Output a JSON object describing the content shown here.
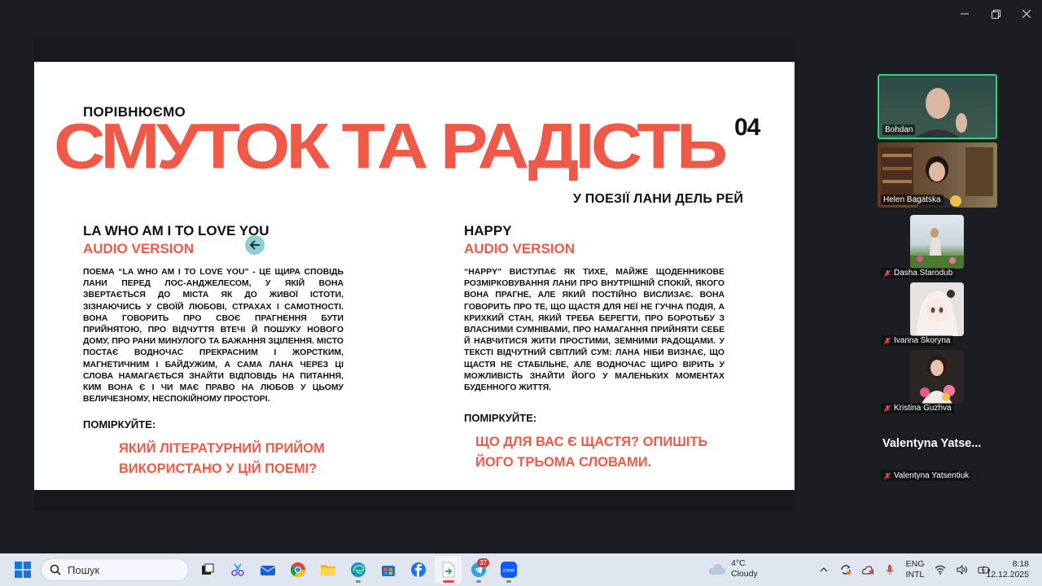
{
  "slide": {
    "pretitle": "ПОРІВНЮЄМО",
    "title": "СМУТОК ТА РАДІСТЬ",
    "number": "04",
    "subtitle": "У ПОЕЗІЇ ЛАНИ ДЕЛЬ РЕЙ",
    "left": {
      "heading": "LA WHO AM I TO LOVE YOU",
      "subheading": "AUDIO VERSION",
      "body": "ПОЕМА “LA WHO AM I TO LOVE YOU” - ЦЕ ЩИРА СПОВІДЬ ЛАНИ ПЕРЕД ЛОС-АНДЖЕЛЕСОМ, У ЯКІЙ ВОНА ЗВЕРТАЄТЬСЯ ДО МІСТА ЯК ДО ЖИВОЇ ІСТОТИ, ЗІЗНАЮЧИСЬ У СВОЇЙ ЛЮБОВІ, СТРАХАХ І САМОТНОСТІ. ВОНА ГОВОРИТЬ ПРО СВОЄ ПРАГНЕННЯ БУТИ ПРИЙНЯТОЮ, ПРО ВІДЧУТТЯ ВТЕЧІ Й ПОШУКУ НОВОГО ДОМУ, ПРО РАНИ МИНУЛОГО ТА БАЖАННЯ ЗЦІЛЕННЯ. МІСТО ПОСТАЄ ВОДНОЧАС ПРЕКРАСНИМ І ЖОРСТКИМ, МАГНЕТИЧНИМ І БАЙДУЖИМ, А САМА ЛАНА ЧЕРЕЗ ЦІ СЛОВА НАМАГАЄТЬСЯ ЗНАЙТИ ВІДПОВІДЬ НА ПИТАННЯ, КИМ ВОНА Є І ЧИ МАЄ ПРАВО НА ЛЮБОВ У ЦЬОМУ ВЕЛИЧЕЗНОМУ, НЕСПОКІЙНОМУ ПРОСТОРІ.",
      "think": "ПОМІРКУЙТЕ:",
      "question": "ЯКИЙ ЛІТЕРАТУРНИЙ ПРИЙОМ ВИКОРИСТАНО У ЦІЙ ПОЕМІ?"
    },
    "right": {
      "heading": "HAPPY",
      "subheading": "AUDIO VERSION",
      "body": "“HAPPY” ВИСТУПАЄ ЯК ТИХЕ, МАЙЖЕ ЩОДЕННИКОВЕ РОЗМІРКОВУВАННЯ ЛАНИ ПРО ВНУТРІШНІЙ СПОКІЙ, ЯКОГО ВОНА ПРАГНЕ, АЛЕ ЯКИЙ ПОСТІЙНО ВИСЛИЗАЄ. ВОНА ГОВОРИТЬ ПРО ТЕ, ЩО ЩАСТЯ ДЛЯ НЕЇ НЕ ГУЧНА ПОДІЯ, А КРИХКИЙ СТАН, ЯКИЙ ТРЕБА БЕРЕГТИ, ПРО БОРОТЬБУ З ВЛАСНИМИ СУМНІВАМИ, ПРО НАМАГАННЯ ПРИЙНЯТИ СЕБЕ Й НАВЧИТИСЯ ЖИТИ ПРОСТИМИ, ЗЕМНИМИ РАДОЩАМИ. У ТЕКСТІ ВІДЧУТНИЙ СВІТЛИЙ СУМ: ЛАНА НІБИ ВИЗНАЄ, ЩО ЩАСТЯ НЕ СТАБІЛЬНЕ, АЛЕ ВОДНОЧАС ЩИРО ВІРИТЬ У МОЖЛИВІСТЬ ЗНАЙТИ ЙОГО У МАЛЕНЬКИХ МОМЕНТАХ БУДЕННОГО ЖИТТЯ.",
      "think": "ПОМІРКУЙТЕ:",
      "question": "ЩО ДЛЯ ВАС Є ЩАСТЯ? ОПИШІТЬ ЙОГО ТРЬОМА СЛОВАМИ."
    }
  },
  "participants": [
    {
      "name": "Bohdan",
      "muted": false,
      "video": true,
      "active": true
    },
    {
      "name": "Helen Bagatska",
      "muted": false,
      "video": true,
      "active": false
    },
    {
      "name": "Dasha Starodub",
      "muted": true,
      "video": false
    },
    {
      "name": "Ivanna Skoryna",
      "muted": true,
      "video": false
    },
    {
      "name": "Kristina Guzhva",
      "muted": true,
      "video": false
    },
    {
      "name": "Valentyna Yatsentiuk",
      "display": "Valentyna  Yatse...",
      "muted": true,
      "video": false
    }
  ],
  "taskbar": {
    "search_placeholder": "Пошук",
    "apps": [
      "task-view",
      "snipping-tool",
      "mail",
      "chrome",
      "file-explorer",
      "edge",
      "store",
      "facebook",
      "active-app",
      "telegram",
      "zoom"
    ],
    "telegram_badge": "37",
    "zoom_label": "zoom",
    "weather_temp": "4°C",
    "weather_desc": "Cloudy",
    "lang_top": "ENG",
    "lang_bottom": "INTL",
    "time": "8:18",
    "date": "12.12.2025"
  },
  "colors": {
    "accent": "#ef5a48",
    "active_border": "#36d27a"
  }
}
